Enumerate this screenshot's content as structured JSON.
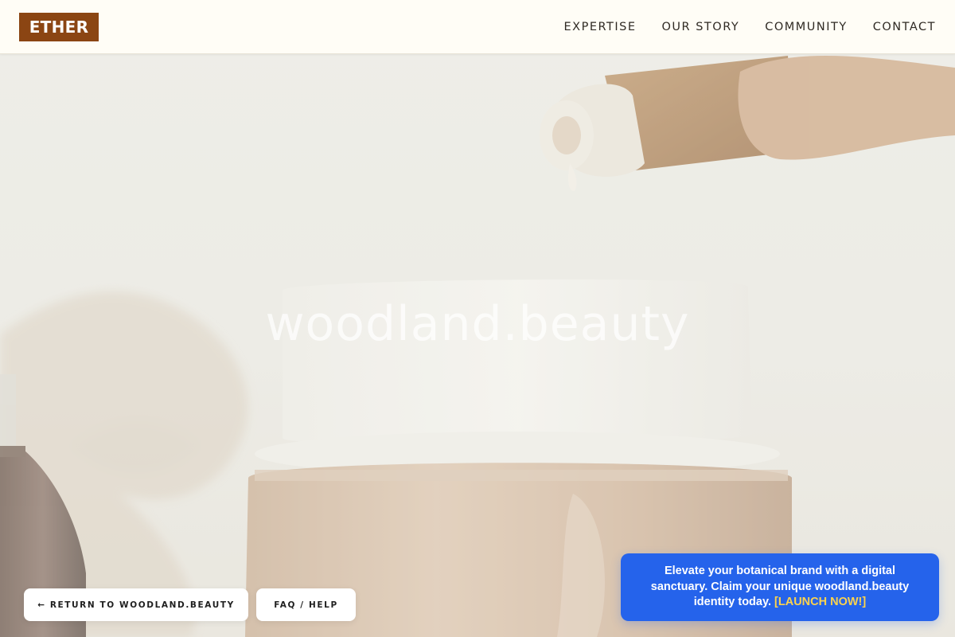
{
  "header": {
    "logo": "ETHER",
    "nav": [
      "EXPERTISE",
      "OUR STORY",
      "COMMUNITY",
      "CONTACT"
    ]
  },
  "hero": {
    "title": "woodland.beauty"
  },
  "actions": {
    "return_label": "← RETURN TO WOODLAND.BEAUTY",
    "faq_label": "FAQ / HELP"
  },
  "promo": {
    "text": "Elevate your botanical brand with a digital sanctuary. Claim your unique woodland.beauty identity today.",
    "cta": "[LAUNCH NOW!]"
  },
  "colors": {
    "logo_bg": "#8b4513",
    "promo_bg": "#2563eb",
    "promo_cta": "#fcd34d",
    "header_bg": "#fffdf6"
  }
}
